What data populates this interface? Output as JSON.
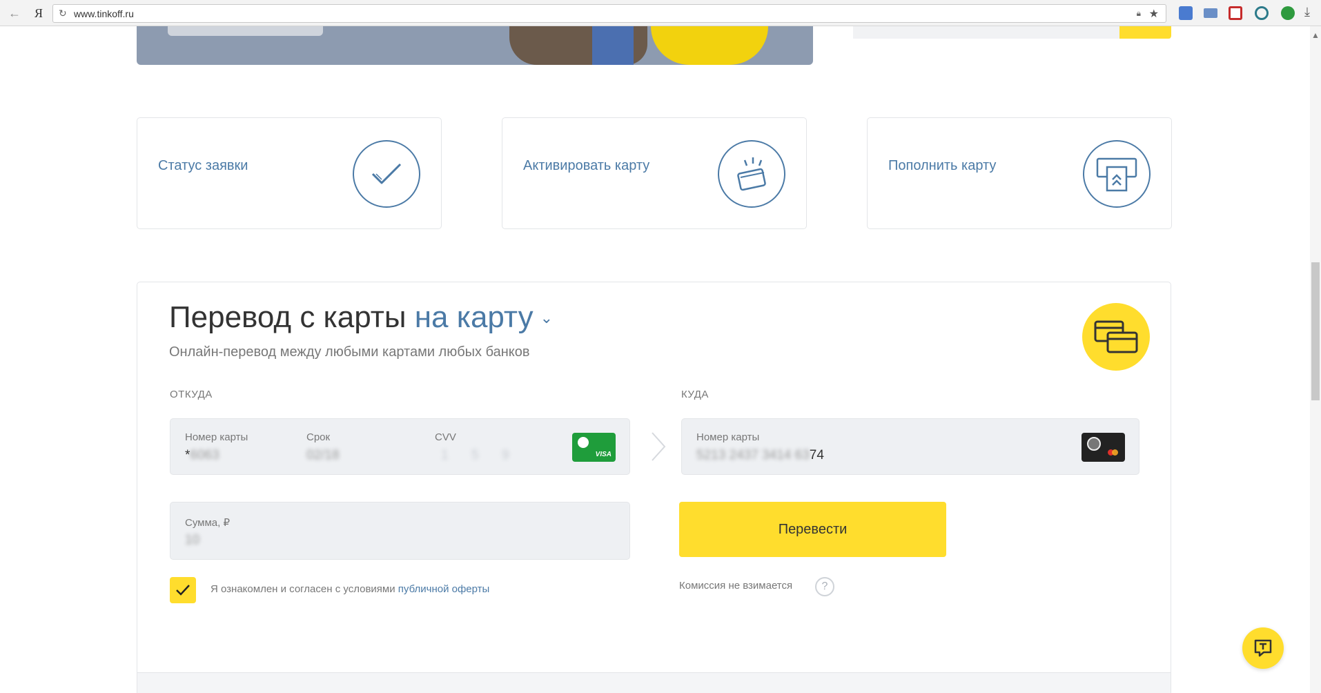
{
  "browser": {
    "back_glyph": "←",
    "yandex_logo": "Я",
    "url": "www.tinkoff.ru"
  },
  "quick_actions": [
    {
      "label": "Статус заявки",
      "icon": "checkmark-icon"
    },
    {
      "label": "Активировать карту",
      "icon": "card-activate-icon"
    },
    {
      "label": "Пополнить карту",
      "icon": "card-topup-icon"
    }
  ],
  "transfer": {
    "title_main": "Перевод с карты",
    "title_accent": "на карту",
    "subtitle": "Онлайн-перевод между любыми картами любых банков",
    "from": {
      "section_label": "ОТКУДА",
      "card_number_label": "Номер карты",
      "card_number_prefix": "*",
      "card_number_masked": "6063",
      "expiry_label": "Срок",
      "expiry_value": "02/18",
      "cvv_label": "CVV",
      "cvv_digits": [
        "1",
        "5",
        "9"
      ],
      "card_brand": "VISA"
    },
    "to": {
      "section_label": "КУДА",
      "card_number_label": "Номер карты",
      "card_number_masked": "5213 2437 3414 63",
      "card_number_visible": "74"
    },
    "amount": {
      "label": "Сумма, ₽",
      "value": "10"
    },
    "submit_label": "Перевести",
    "agree_text": "Я ознакомлен и согласен с условиями",
    "agree_link": "публичной оферты",
    "commission_text": "Комиссия не взимается",
    "help_glyph": "?"
  },
  "colors": {
    "accent_yellow": "#ffdd2d",
    "link_blue": "#4b7aa6",
    "field_bg": "#eef0f3",
    "sber_green": "#1f9d3b"
  }
}
